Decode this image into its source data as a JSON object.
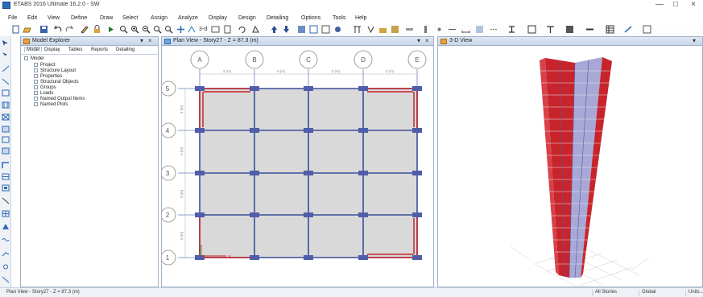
{
  "app": {
    "title": "ETABS 2016 Ultimate 16.2.0 - SW"
  },
  "window_controls": {
    "minimize": "—",
    "maximize": "□",
    "close": "×"
  },
  "menu": [
    "File",
    "Edit",
    "View",
    "Define",
    "Draw",
    "Select",
    "Assign",
    "Analyze",
    "Display",
    "Design",
    "Detailing",
    "Options",
    "Tools",
    "Help"
  ],
  "toolbar": {
    "label_3d": "3-d"
  },
  "explorer": {
    "title": "Model Explorer",
    "pin": "▾",
    "close": "×",
    "tabs": [
      "Model",
      "Display",
      "Tables",
      "Reports",
      "Detailing"
    ],
    "root": "Model",
    "items": [
      "Project",
      "Structure Layout",
      "Properties",
      "Structural Objects",
      "Groups",
      "Loads",
      "Named Output Items",
      "Named Plots"
    ]
  },
  "plan": {
    "title": "Plan View - Story27 - Z = 87.3 (m)",
    "pin": "▾",
    "close": "×",
    "grid_x": [
      "A",
      "B",
      "C",
      "D",
      "E"
    ],
    "grid_y": [
      "5",
      "4",
      "3",
      "2",
      "1"
    ],
    "spacing_x": [
      "3 (m)",
      "3 (m)",
      "3 (m)",
      "3 (m)"
    ],
    "spacing_y": [
      "3 (m)",
      "3 (m)",
      "3 (m)",
      "3 (m)"
    ]
  },
  "view3d": {
    "title": "3-D View",
    "pin": "▾"
  },
  "status": {
    "text": "Plan View - Story27 - Z = 87.3 (m)",
    "stories": "All Stories",
    "coord": "Global",
    "units": "Units..."
  },
  "colors": {
    "accent": "#2d6bb5",
    "wall": "#c8242b",
    "beam": "#3a4e9a",
    "slab": "#dadada"
  }
}
